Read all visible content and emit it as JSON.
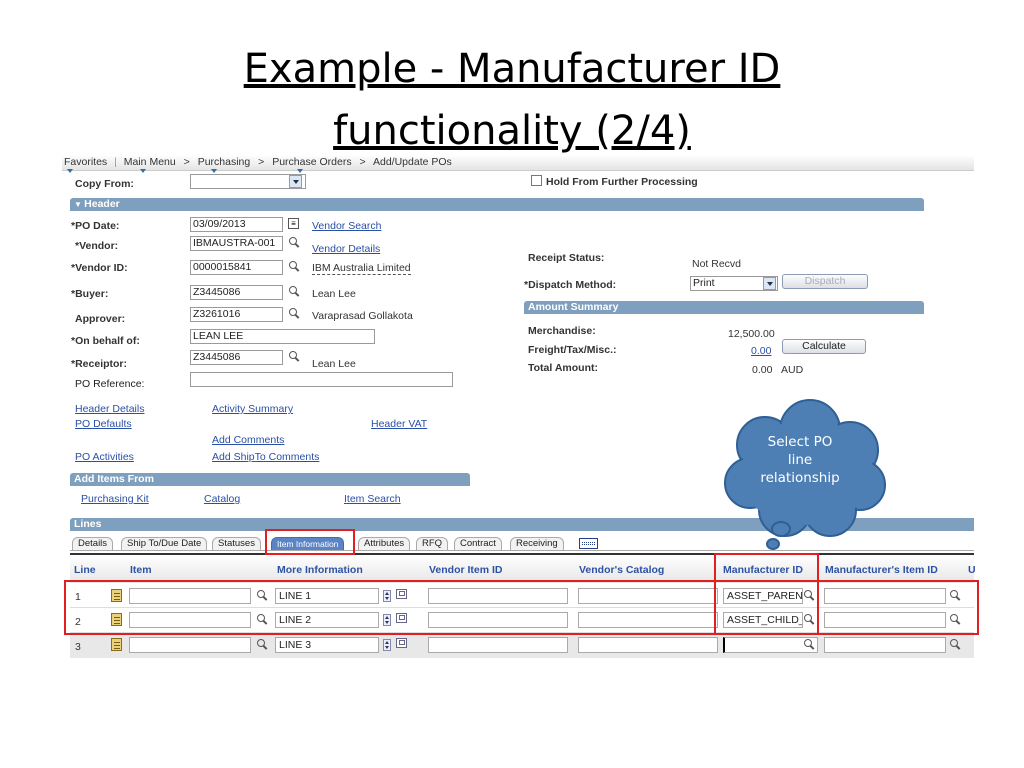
{
  "slide": {
    "title_line1": "Example - Manufacturer ID",
    "title_line2": "functionality (2/4)"
  },
  "breadcrumb": {
    "favorites": "Favorites",
    "main_menu": "Main Menu",
    "purchasing": "Purchasing",
    "purchase_orders": "Purchase Orders",
    "add_update": "Add/Update POs",
    "sep1": "|",
    "sep2": ">",
    "sep3": ">",
    "sep4": ">"
  },
  "form": {
    "copy_from_label": "Copy From:",
    "copy_from_value": "",
    "hold_label": "Hold From Further Processing",
    "header_section": "Header",
    "po_date_label": "*PO Date:",
    "po_date_value": "03/09/2013",
    "vendor_search_link": "Vendor Search",
    "vendor_label": "*Vendor:",
    "vendor_value": "IBMAUSTRA-001",
    "vendor_details_link": "Vendor Details",
    "vendor_id_label": "*Vendor ID:",
    "vendor_id_value": "0000015841",
    "vendor_name": "IBM Australia Limited",
    "buyer_label": "*Buyer:",
    "buyer_value": "Z3445086",
    "buyer_name": "Lean Lee",
    "approver_label": "Approver:",
    "approver_value": "Z3261016",
    "approver_name": "Varaprasad Gollakota",
    "on_behalf_label": "*On behalf of:",
    "on_behalf_value": "LEAN LEE",
    "receiptor_label": "*Receiptor:",
    "receiptor_value": "Z3445086",
    "receiptor_name": "Lean Lee",
    "po_reference_label": "PO Reference:",
    "po_reference_value": "",
    "receipt_status_label": "Receipt Status:",
    "receipt_status_value": "Not Recvd",
    "dispatch_method_label": "*Dispatch Method:",
    "dispatch_method_value": "Print",
    "dispatch_button": "Dispatch",
    "amount_summary_section": "Amount Summary",
    "merchandise_label": "Merchandise:",
    "merchandise_value": "12,500.00",
    "freight_label": "Freight/Tax/Misc.:",
    "freight_value": "0.00",
    "calculate_button": "Calculate",
    "total_label": "Total Amount:",
    "total_value": "0.00",
    "currency": "AUD"
  },
  "links": {
    "header_details": "Header Details",
    "activity_summary": "Activity Summary",
    "po_defaults": "PO Defaults",
    "header_vat": "Header VAT",
    "add_comments": "Add Comments",
    "po_activities": "PO Activities",
    "add_shipto_comments": "Add ShipTo Comments"
  },
  "add_items": {
    "section": "Add Items From",
    "purchasing_kit": "Purchasing Kit",
    "catalog": "Catalog",
    "item_search": "Item Search"
  },
  "lines": {
    "section": "Lines",
    "tabs": [
      "Details",
      "Ship To/Due Date",
      "Statuses",
      "Item Information",
      "Attributes",
      "RFQ",
      "Contract",
      "Receiving"
    ],
    "columns": [
      "Line",
      "Item",
      "More Information",
      "Vendor Item ID",
      "Vendor's Catalog",
      "Manufacturer ID",
      "Manufacturer's Item ID",
      "U"
    ],
    "rows": [
      {
        "line": "1",
        "item": "",
        "more_info": "LINE 1",
        "vendor_item_id": "",
        "vendors_catalog": "",
        "manufacturer_id": "ASSET_PARENT",
        "mfg_item_id": ""
      },
      {
        "line": "2",
        "item": "",
        "more_info": "LINE 2",
        "vendor_item_id": "",
        "vendors_catalog": "",
        "manufacturer_id": "ASSET_CHILD_(",
        "mfg_item_id": ""
      },
      {
        "line": "3",
        "item": "",
        "more_info": "LINE 3",
        "vendor_item_id": "",
        "vendors_catalog": "",
        "manufacturer_id": "",
        "mfg_item_id": ""
      }
    ]
  },
  "callout": {
    "line1": "Select PO",
    "line2": "line",
    "line3": "relationship"
  },
  "colors": {
    "section_bar": "#7e9fbd",
    "link": "#2a4fa6",
    "highlight": "#e02020",
    "callout_fill": "#4d7fb5",
    "callout_border": "#2f5f95"
  },
  "icons": [
    "magnifier-icon",
    "calendar-icon",
    "spinner-icon",
    "popup-icon",
    "document-icon",
    "dropdown-arrow-icon",
    "grid-view-icon"
  ]
}
